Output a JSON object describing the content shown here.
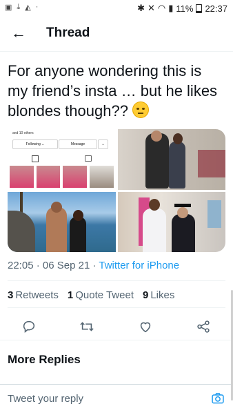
{
  "status_bar": {
    "time": "22:37",
    "battery": "11%",
    "left_icons": [
      "image-icon",
      "download-icon",
      "chart-icon",
      "dot-icon"
    ],
    "right_icons": [
      "bluetooth-icon",
      "mute-icon",
      "wifi-icon",
      "signal-icon",
      "battery-icon"
    ]
  },
  "header": {
    "title": "Thread",
    "back_icon": "arrow-left-icon"
  },
  "tweet": {
    "text": "For anyone wondering this is my friend’s insta … but he likes blondes though?? ",
    "emoji": "face-with-rolling-eyes",
    "media": {
      "tile1": {
        "followers_text": "and 10 others",
        "following_label": "Following ⌄",
        "message_label": "Message",
        "more_label": "⌄"
      }
    },
    "time": "22:05",
    "date": "06 Sep 21",
    "source": "Twitter for iPhone",
    "separator": "·",
    "retweets_count": "3",
    "retweets_label": "Retweets",
    "quotes_count": "1",
    "quotes_label": "Quote Tweet",
    "likes_count": "9",
    "likes_label": "Likes"
  },
  "actions": [
    "reply-icon",
    "retweet-icon",
    "like-icon",
    "share-icon"
  ],
  "more_replies": "More Replies",
  "reply_bar": {
    "placeholder": "Tweet your reply",
    "camera_icon": "camera-icon"
  },
  "colors": {
    "accent": "#1d9bf0",
    "text": "#0f1419",
    "muted": "#536471"
  }
}
